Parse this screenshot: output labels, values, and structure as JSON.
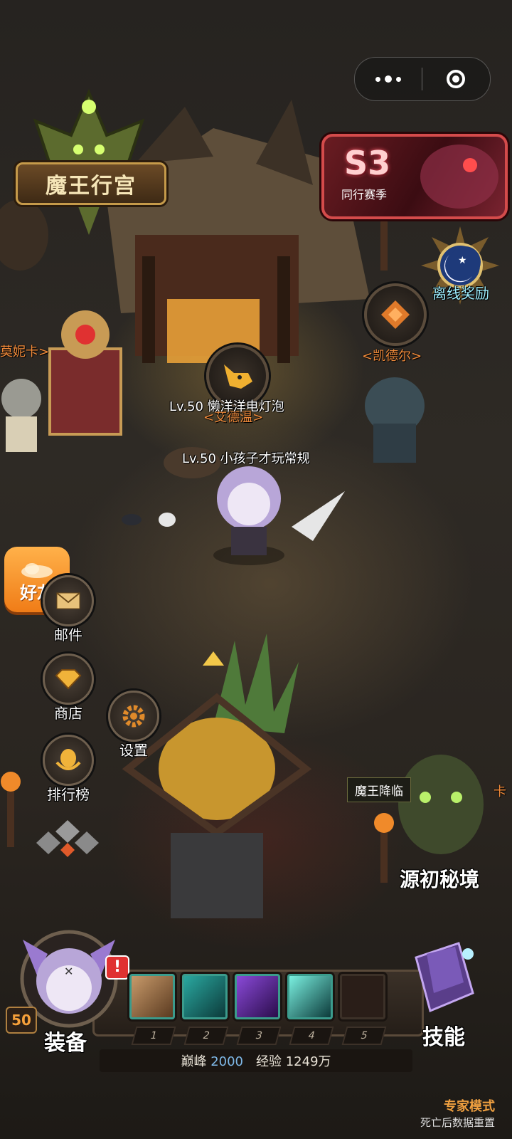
{
  "castle": {
    "name": "魔王行宫"
  },
  "season": {
    "big": "S3",
    "sub": "同行赛季"
  },
  "offline_reward": {
    "label": "离线奖励"
  },
  "npcs": {
    "left_partial": "莫妮卡>",
    "caldor": "<凯德尔>",
    "adelwen": "<艾德温>"
  },
  "players": {
    "p1": "Lv.50 懒洋洋电灯泡",
    "p2": "Lv.50 小孩子才玩常规"
  },
  "side_menu": {
    "friends": "好友",
    "mail": "邮件",
    "shop": "商店",
    "settings": "设置",
    "ranking": "排行榜"
  },
  "dungeon": {
    "tag": "魔王降临",
    "name": "源初秘境",
    "edge_partial": "卡"
  },
  "bottom": {
    "level": "50",
    "equip": "装备",
    "skills": "技能",
    "alert": "!",
    "slots": [
      "1",
      "2",
      "3",
      "4",
      "5"
    ],
    "peak_label": "巅峰",
    "peak_value": "2000",
    "exp_label": "经验",
    "exp_value": "1249万"
  },
  "mode": {
    "title": "专家模式",
    "sub": "死亡后数据重置"
  },
  "colors": {
    "accent_orange": "#f07c17",
    "npc_name": "#f08a3a",
    "season_red": "#d44b4b",
    "teal": "#3b9b8c"
  }
}
